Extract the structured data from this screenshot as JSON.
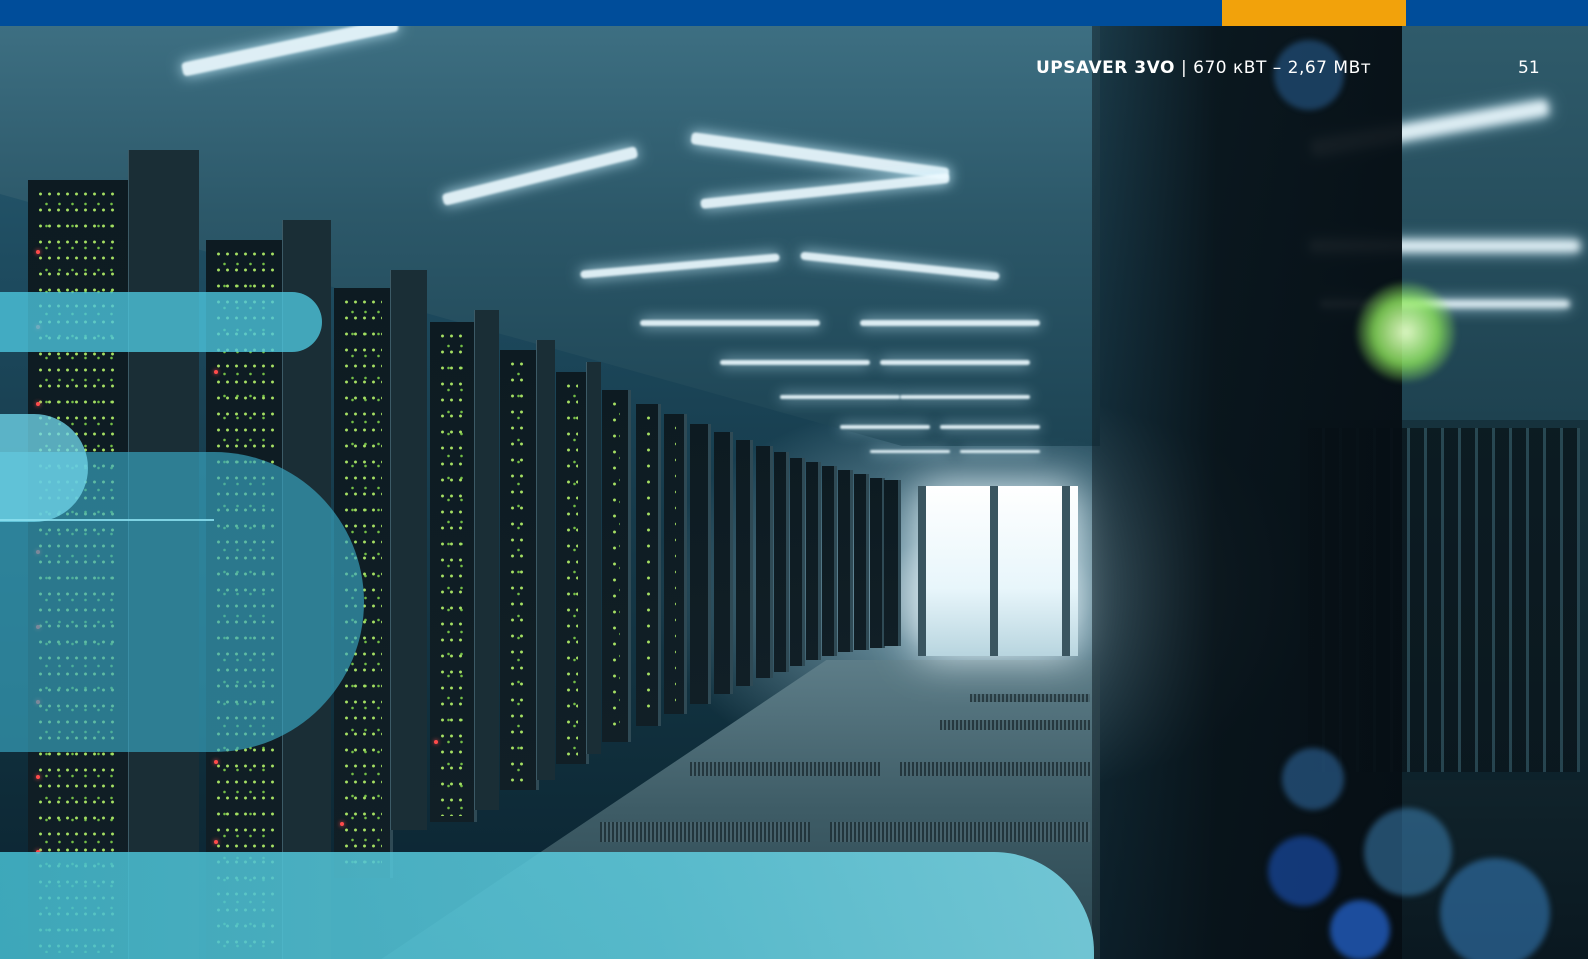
{
  "header": {
    "brand": "UPSAVER 3VO",
    "separator": "|",
    "range": "670 кВТ – 2,67 МВт"
  },
  "page_number": "51",
  "colors": {
    "top_band": "#004d9a",
    "accent": "#f2a20b",
    "overlay_cyan": "#40b2cc"
  },
  "image": {
    "subject": "data-center-server-corridor"
  }
}
